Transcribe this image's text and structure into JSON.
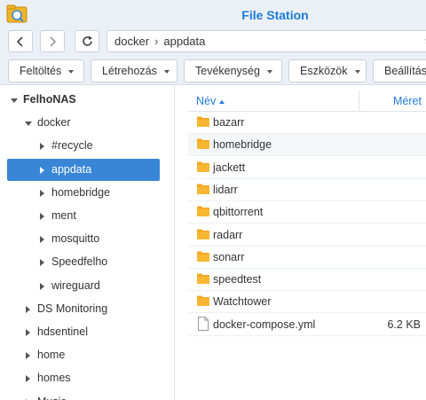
{
  "window": {
    "title": "File Station"
  },
  "path": {
    "segments": [
      "docker",
      "appdata"
    ],
    "separator": "›"
  },
  "toolbar": [
    {
      "label": "Feltöltés"
    },
    {
      "label": "Létrehozás"
    },
    {
      "label": "Tevékenység"
    },
    {
      "label": "Eszközök"
    },
    {
      "label": "Beállítás"
    }
  ],
  "tree": [
    {
      "label": "FelhoNAS",
      "level": 0,
      "expanded": true,
      "bold": true
    },
    {
      "label": "docker",
      "level": 1,
      "expanded": true
    },
    {
      "label": "#recycle",
      "level": 2,
      "expanded": false
    },
    {
      "label": "appdata",
      "level": 2,
      "expanded": false,
      "selected": true
    },
    {
      "label": "homebridge",
      "level": 2,
      "expanded": false
    },
    {
      "label": "ment",
      "level": 2,
      "expanded": false
    },
    {
      "label": "mosquitto",
      "level": 2,
      "expanded": false
    },
    {
      "label": "Speedfelho",
      "level": 2,
      "expanded": false
    },
    {
      "label": "wireguard",
      "level": 2,
      "expanded": false
    },
    {
      "label": "DS Monitoring",
      "level": 1,
      "expanded": false
    },
    {
      "label": "hdsentinel",
      "level": 1,
      "expanded": false
    },
    {
      "label": "home",
      "level": 1,
      "expanded": false
    },
    {
      "label": "homes",
      "level": 1,
      "expanded": false
    },
    {
      "label": "Music",
      "level": 1,
      "expanded": false
    }
  ],
  "columns": {
    "name": "Név",
    "size": "Méret"
  },
  "files": [
    {
      "name": "bazarr",
      "type": "folder",
      "size": ""
    },
    {
      "name": "homebridge",
      "type": "folder",
      "size": ""
    },
    {
      "name": "jackett",
      "type": "folder",
      "size": ""
    },
    {
      "name": "lidarr",
      "type": "folder",
      "size": ""
    },
    {
      "name": "qbittorrent",
      "type": "folder",
      "size": ""
    },
    {
      "name": "radarr",
      "type": "folder",
      "size": ""
    },
    {
      "name": "sonarr",
      "type": "folder",
      "size": ""
    },
    {
      "name": "speedtest",
      "type": "folder",
      "size": ""
    },
    {
      "name": "Watchtower",
      "type": "folder",
      "size": ""
    },
    {
      "name": "docker-compose.yml",
      "type": "file",
      "size": "6.2 KB"
    }
  ],
  "colors": {
    "accent": "#1f7ad8",
    "selected": "#3a86d6",
    "folder": "#f5a623"
  }
}
